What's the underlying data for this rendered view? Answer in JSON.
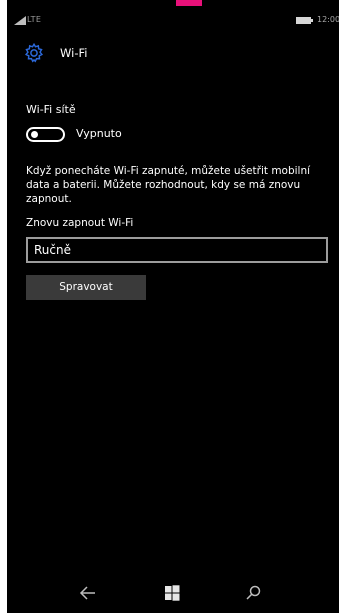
{
  "status_bar": {
    "network": "LTE",
    "time": "12:00",
    "icons": [
      "signal-icon",
      "battery-icon"
    ]
  },
  "header": {
    "icon": "gear-icon",
    "title": "Wi-Fi"
  },
  "wifi": {
    "section_label": "Wi-Fi sítě",
    "toggle_state": "Vypnuto",
    "toggle_on": false,
    "description": "Když ponecháte Wi-Fi zapnuté, můžete ušetřit mobilní data a baterii. Můžete rozhodnout, kdy se má znovu zapnout.",
    "reenable_label": "Znovu zapnout Wi-Fi",
    "reenable_value": "Ručně",
    "manage_button": "Spravovat"
  },
  "navbar": {
    "icons": [
      "back-arrow-icon",
      "windows-logo-icon",
      "search-icon"
    ]
  },
  "colors": {
    "background": "#000000",
    "accent": "#e8117a",
    "gear_icon": "#2b68d9",
    "button_bg": "#3a3a3a"
  }
}
